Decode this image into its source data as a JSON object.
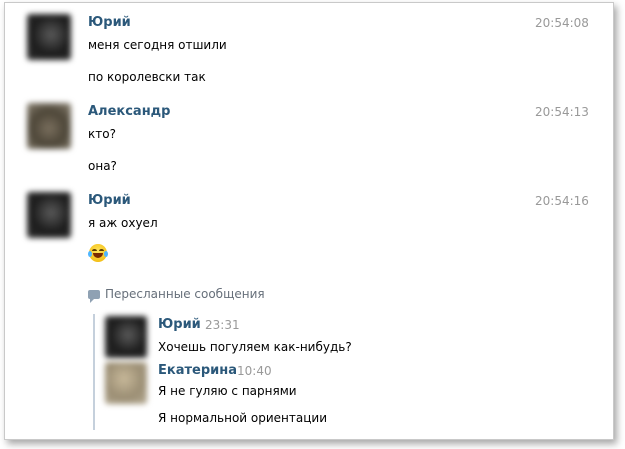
{
  "messages": [
    {
      "author": "Юрий",
      "time": "20:54:08",
      "lines": [
        "меня сегодня отшили",
        "по королевски так"
      ]
    },
    {
      "author": "Александр",
      "time": "20:54:13",
      "lines": [
        "кто?",
        "она?"
      ]
    },
    {
      "author": "Юрий",
      "time": "20:54:16",
      "lines": [
        "я аж охуел"
      ],
      "emoji": "face-with-tears-of-joy-icon"
    }
  ],
  "forwarded": {
    "header": "Пересланные сообщения",
    "items": [
      {
        "author": "Юрий",
        "time": "23:31",
        "lines": [
          "Хочешь погуляем как-нибудь?"
        ]
      },
      {
        "author": "Екатерина",
        "time": "10:40",
        "lines": [
          "Я не гуляю с парнями",
          "Я нормальной ориентации"
        ]
      }
    ]
  },
  "colors": {
    "author": "#2b587a",
    "time": "#999999",
    "forward_bar": "#c5d0dc"
  }
}
